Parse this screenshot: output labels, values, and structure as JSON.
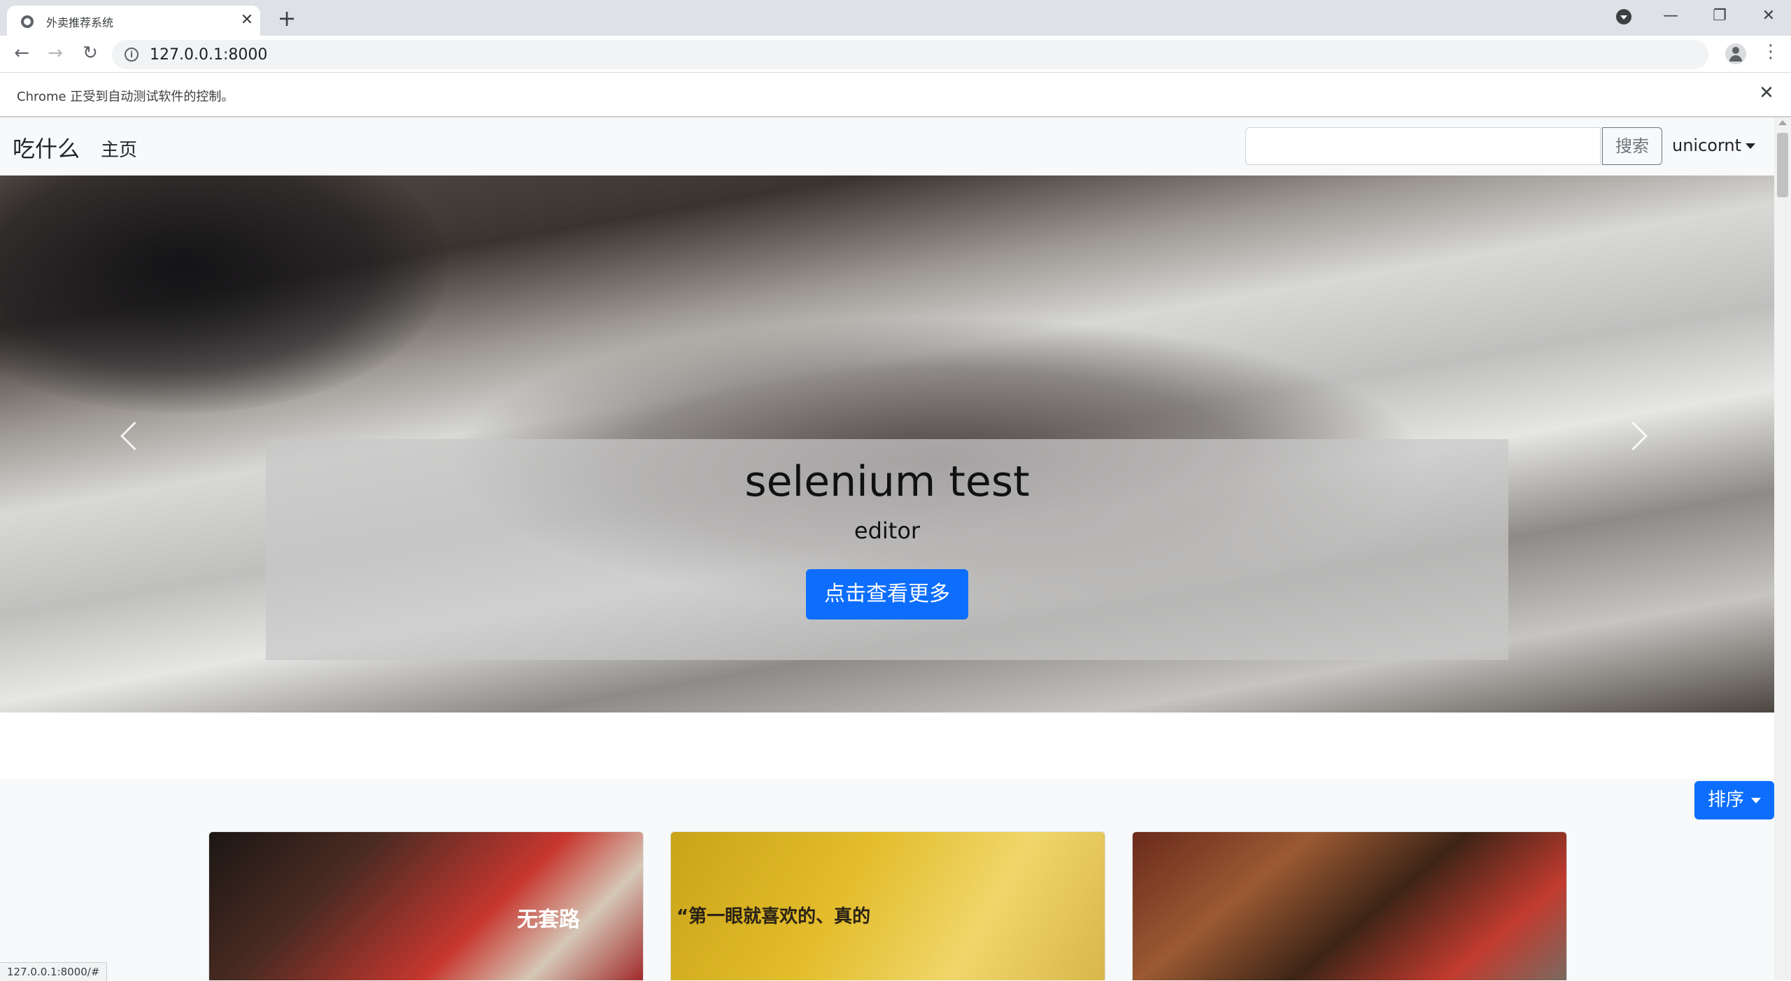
{
  "browser": {
    "tab_title": "外卖推荐系统",
    "tab_close": "✕",
    "new_tab": "+",
    "url": "127.0.0.1:8000",
    "window_controls": [
      "—",
      "❐",
      "✕"
    ],
    "icons": [
      "back-icon",
      "forward-icon",
      "reload-icon",
      "info-icon",
      "star-icon",
      "account-icon",
      "menu-icon"
    ]
  },
  "infobar": {
    "text": "Chrome 正受到自动测试软件的控制。",
    "close": "✕"
  },
  "navbar": {
    "brand": "吃什么",
    "home": "主页",
    "search_value": "",
    "search_button": "搜索",
    "user": "unicornt"
  },
  "carousel": {
    "title": "selenium test",
    "subtitle": "editor",
    "button": "点击查看更多",
    "active_index": 0,
    "indicator_count": 3
  },
  "content": {
    "sort_button": "排序"
  },
  "cards": [
    {
      "text": "无套路"
    },
    {
      "text": "“第一眼就喜欢的、真的"
    },
    {
      "text": ""
    }
  ],
  "status": {
    "url": "127.0.0.1:8000/#"
  },
  "colors": {
    "primary": "#0d6efd",
    "navbar_bg": "#f8f9fa",
    "tabstrip_bg": "#dee1e6"
  }
}
